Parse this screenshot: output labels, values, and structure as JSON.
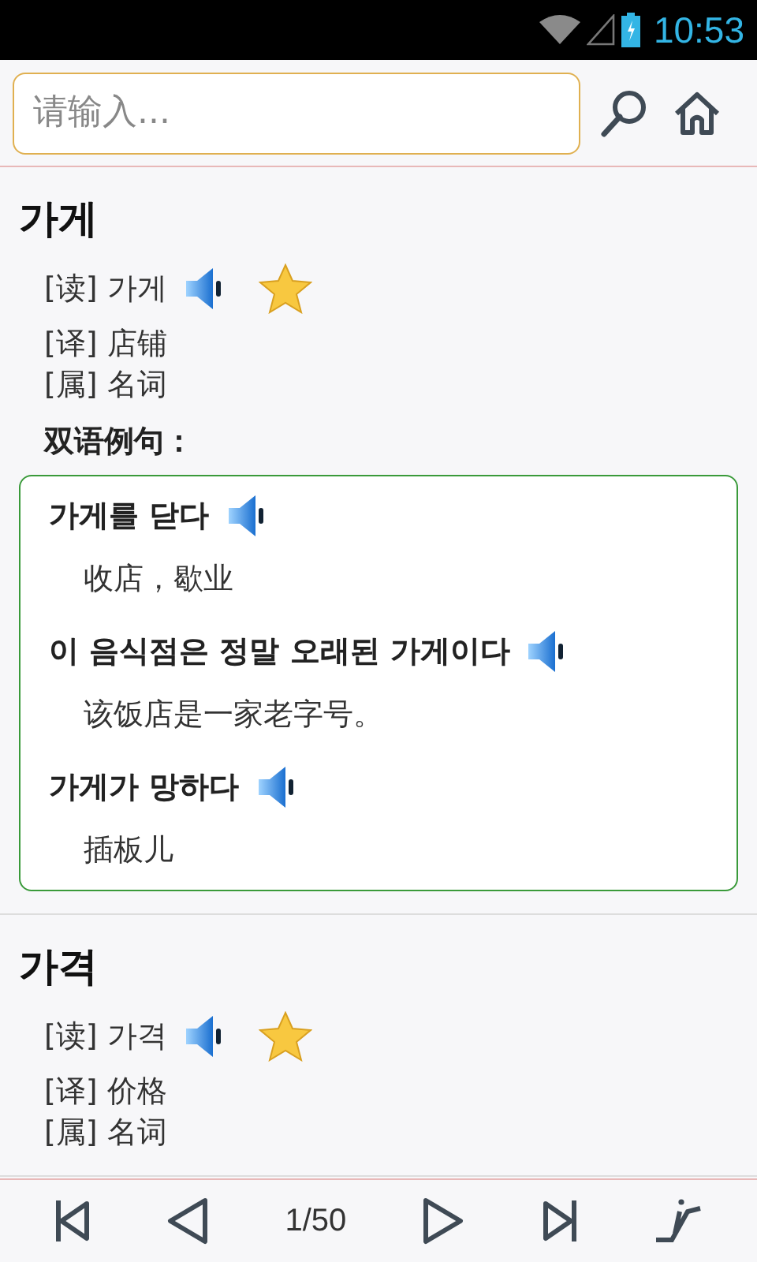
{
  "status_bar": {
    "time": "10:53"
  },
  "search": {
    "placeholder": "请输入..."
  },
  "entries": [
    {
      "word": "가게",
      "reading": "[读] 가게",
      "translation": "[译] 店铺",
      "pos": "[属] 名词",
      "examples_heading": "双语例句：",
      "examples": [
        {
          "sentence": "가게를 닫다",
          "translation": "收店，歇业"
        },
        {
          "sentence": "이 음식점은 정말 오래된 가게이다",
          "translation": "该饭店是一家老字号。"
        },
        {
          "sentence": "가게가 망하다",
          "translation": "插板儿"
        }
      ]
    },
    {
      "word": "가격",
      "reading": "[读] 가격",
      "translation": "[译] 价格",
      "pos": "[属] 名词"
    }
  ],
  "pager": {
    "page": "1/50"
  }
}
